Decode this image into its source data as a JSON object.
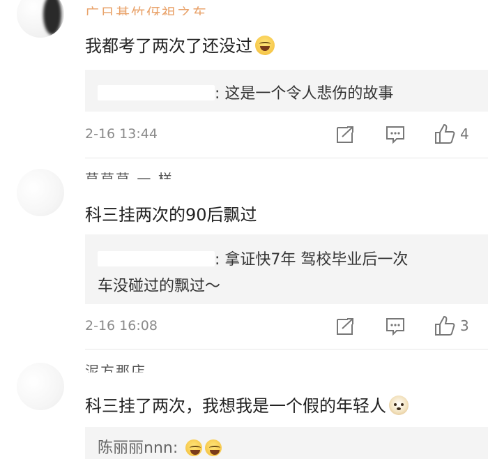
{
  "comments": [
    {
      "username": "广日基竹伢祖之车",
      "text": "我都考了两次了还没过",
      "emoji": "laugh-cry-icon",
      "reply_name": "",
      "reply_text": "这是一个令人悲伤的故事",
      "time": "2-16 13:44",
      "likes": "4"
    },
    {
      "username": "草草草 一 样",
      "text": "科三挂两次的90后飘过",
      "reply_name": "",
      "reply_text": "拿证快7年 驾校毕业后一次",
      "reply_text_2": "车没碰过的飘过～",
      "time": "2-16 16:08",
      "likes": "3"
    },
    {
      "username": "泥方那店",
      "text": "科三挂了两次，我想我是一个假的年轻人",
      "emoji": "doge-icon",
      "reply_name": "陈丽丽nnn",
      "reply_emojis": [
        "laugh-cry-icon",
        "laugh-cry-icon"
      ]
    }
  ]
}
